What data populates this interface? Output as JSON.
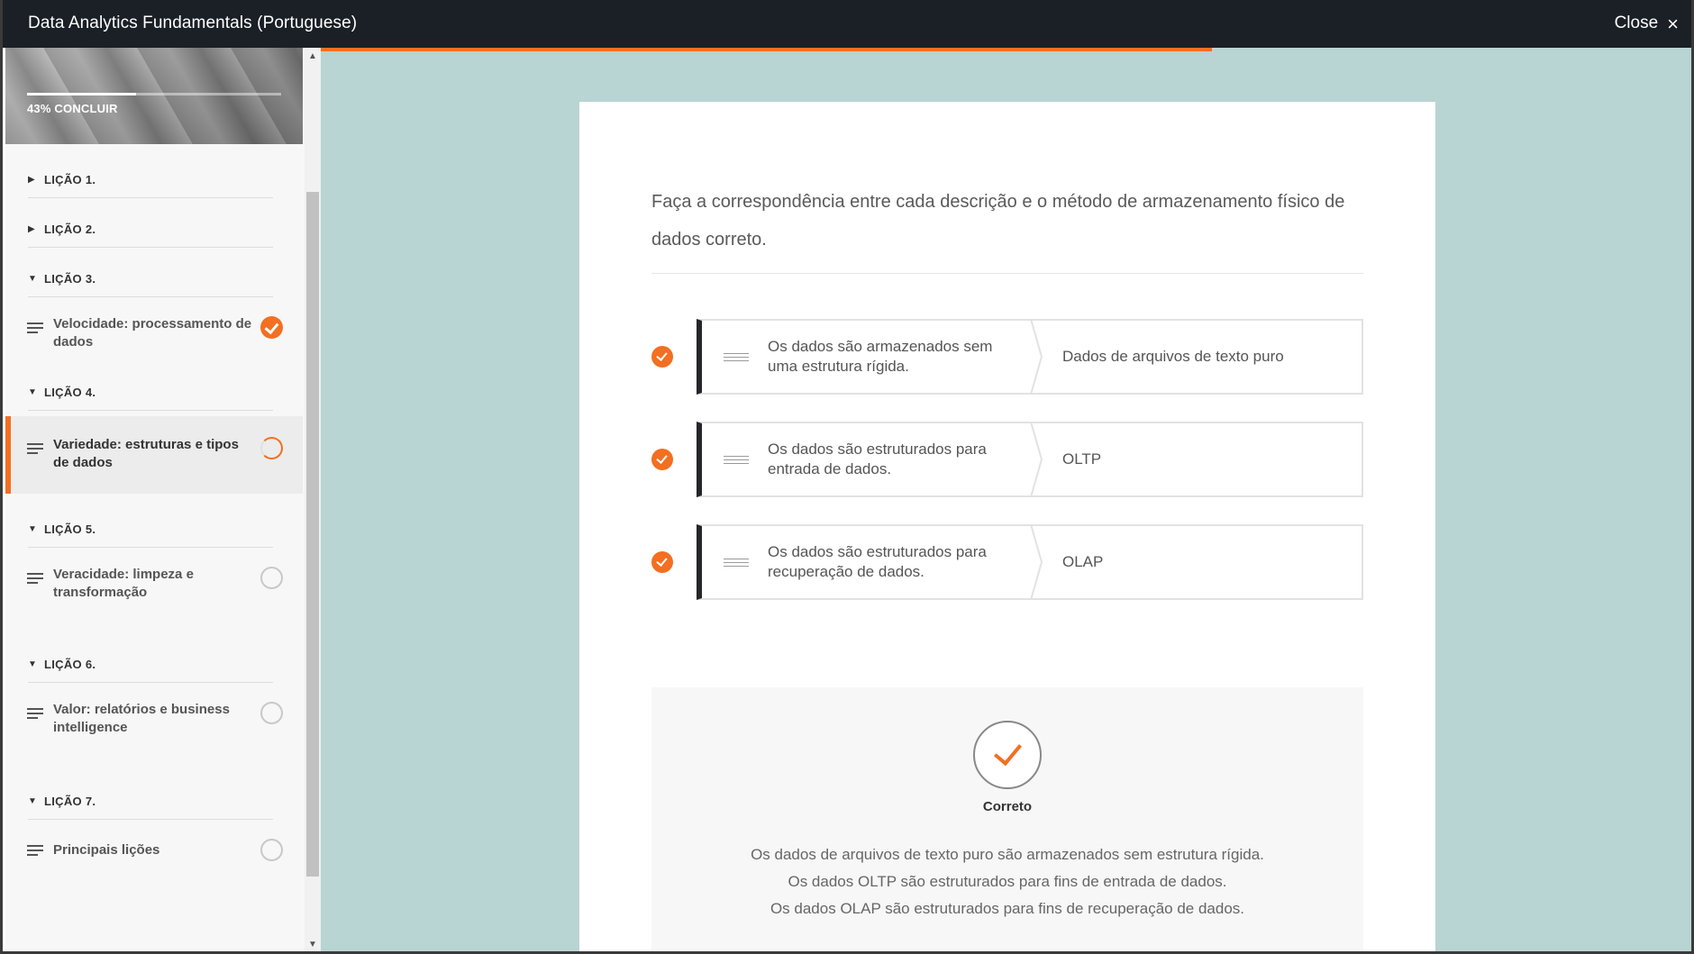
{
  "window": {
    "title": "Data Analytics Fundamentals (Portuguese)",
    "close_label": "Close"
  },
  "sidebar": {
    "progress_label": "43% CONCLUIR",
    "progress_fraction": 0.43,
    "lessons": [
      {
        "label": "LIÇÃO 1.",
        "expanded": false
      },
      {
        "label": "LIÇÃO 2.",
        "expanded": false
      },
      {
        "label": "LIÇÃO 3.",
        "expanded": true
      },
      {
        "label": "LIÇÃO 4.",
        "expanded": true
      },
      {
        "label": "LIÇÃO 5.",
        "expanded": true
      },
      {
        "label": "LIÇÃO 6.",
        "expanded": true
      },
      {
        "label": "LIÇÃO 7.",
        "expanded": true
      }
    ],
    "items": [
      {
        "label": "Velocidade: processamento de dados",
        "status": "complete"
      },
      {
        "label": "Variedade: estruturas e tipos de dados",
        "status": "in-progress"
      },
      {
        "label": "Veracidade: limpeza e transformação",
        "status": "not-started"
      },
      {
        "label": "Valor: relatórios e business intelligence",
        "status": "not-started"
      },
      {
        "label": "Principais lições",
        "status": "not-started"
      }
    ]
  },
  "main": {
    "question": "Faça a correspondência entre cada descrição e o método de armazenamento físico de dados correto.",
    "matches": [
      {
        "description": "Os dados são armazenados sem uma estrutura rígida.",
        "answer": "Dados de arquivos de texto puro"
      },
      {
        "description": "Os dados são estruturados para entrada de dados.",
        "answer": "OLTP"
      },
      {
        "description": "Os dados são estruturados para recuperação de dados.",
        "answer": "OLAP"
      }
    ],
    "feedback": {
      "label": "Correto",
      "lines": [
        "Os dados de arquivos de texto puro são armazenados sem estrutura rígida.",
        "Os dados OLTP são estruturados para fins de entrada de dados.",
        "Os dados OLAP são estruturados para fins de recuperação de dados."
      ]
    }
  },
  "colors": {
    "accent": "#f36f21",
    "topbar": "#1b1f26",
    "background": "#b8d4d3"
  }
}
